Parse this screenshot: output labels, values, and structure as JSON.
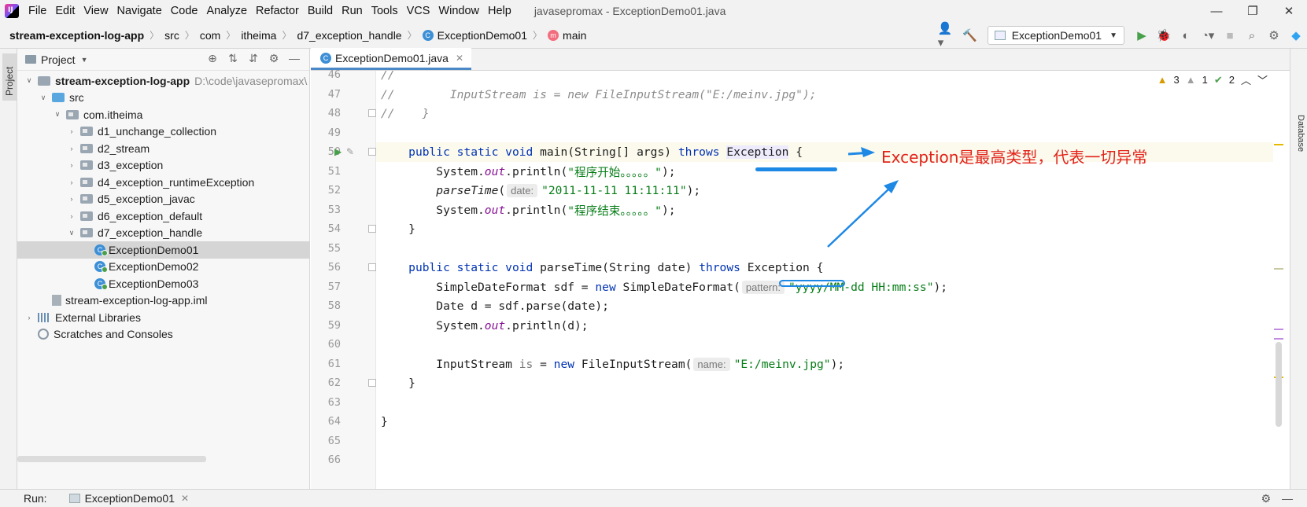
{
  "window": {
    "title": "javasepromax - ExceptionDemo01.java",
    "controls": [
      "—",
      "❐",
      "✕"
    ]
  },
  "menu": [
    "File",
    "Edit",
    "View",
    "Navigate",
    "Code",
    "Analyze",
    "Refactor",
    "Build",
    "Run",
    "Tools",
    "VCS",
    "Window",
    "Help"
  ],
  "breadcrumb": [
    "stream-exception-log-app",
    "src",
    "com",
    "itheima",
    "d7_exception_handle",
    "ExceptionDemo01",
    "main"
  ],
  "toolbar": {
    "run_config": "ExceptionDemo01"
  },
  "project_panel": {
    "title": "Project",
    "stripe_label": "Project",
    "tree": [
      {
        "label": "stream-exception-log-app",
        "note": "D:\\code\\javasepromax\\",
        "depth": 0,
        "icon": "folder",
        "expanded": true,
        "bold": true
      },
      {
        "label": "src",
        "depth": 1,
        "icon": "source-folder",
        "expanded": true
      },
      {
        "label": "com.itheima",
        "depth": 2,
        "icon": "package",
        "expanded": true
      },
      {
        "label": "d1_unchange_collection",
        "depth": 3,
        "icon": "package",
        "expanded": false
      },
      {
        "label": "d2_stream",
        "depth": 3,
        "icon": "package",
        "expanded": false
      },
      {
        "label": "d3_exception",
        "depth": 3,
        "icon": "package",
        "expanded": false
      },
      {
        "label": "d4_exception_runtimeException",
        "depth": 3,
        "icon": "package",
        "expanded": false
      },
      {
        "label": "d5_exception_javac",
        "depth": 3,
        "icon": "package",
        "expanded": false
      },
      {
        "label": "d6_exception_default",
        "depth": 3,
        "icon": "package",
        "expanded": false
      },
      {
        "label": "d7_exception_handle",
        "depth": 3,
        "icon": "package",
        "expanded": true
      },
      {
        "label": "ExceptionDemo01",
        "depth": 4,
        "icon": "class",
        "selected": true
      },
      {
        "label": "ExceptionDemo02",
        "depth": 4,
        "icon": "class"
      },
      {
        "label": "ExceptionDemo03",
        "depth": 4,
        "icon": "class"
      },
      {
        "label": "stream-exception-log-app.iml",
        "depth": 1,
        "icon": "iml"
      },
      {
        "label": "External Libraries",
        "depth": 0,
        "icon": "library",
        "expanded": false
      },
      {
        "label": "Scratches and Consoles",
        "depth": 0,
        "icon": "scratch"
      }
    ]
  },
  "editor": {
    "tab": "ExceptionDemo01.java",
    "inspections": {
      "warnings": "3",
      "weak_warnings": "1",
      "typos": "2"
    },
    "current_line": "50",
    "lines": [
      {
        "n": "46",
        "tokens": [
          {
            "t": "//",
            "c": "cmt"
          }
        ]
      },
      {
        "n": "47",
        "tokens": [
          {
            "t": "//        InputStream is = new FileInputStream(\"E:/meinv.jpg\");",
            "c": "cmt"
          }
        ]
      },
      {
        "n": "48",
        "tokens": [
          {
            "t": "//    }",
            "c": "cmt"
          }
        ]
      },
      {
        "n": "49",
        "tokens": []
      },
      {
        "n": "50",
        "tokens": [
          {
            "t": "    "
          },
          {
            "t": "public static void ",
            "c": "kw"
          },
          {
            "t": "main(String[] args) "
          },
          {
            "t": "throws ",
            "c": "kw"
          },
          {
            "t": "Exception",
            "c": "cursor-word"
          },
          {
            "t": " {"
          }
        ]
      },
      {
        "n": "51",
        "tokens": [
          {
            "t": "        System."
          },
          {
            "t": "out",
            "c": "fld"
          },
          {
            "t": ".println("
          },
          {
            "t": "\"程序开始。。。。。\"",
            "c": "str"
          },
          {
            "t": ");"
          }
        ]
      },
      {
        "n": "52",
        "tokens": [
          {
            "t": "        "
          },
          {
            "t": "parseTime",
            "c": "static-call"
          },
          {
            "t": "("
          },
          {
            "t": "date:",
            "c": "hint"
          },
          {
            "t": "\"2011-11-11 11:11:11\"",
            "c": "str"
          },
          {
            "t": ");"
          }
        ]
      },
      {
        "n": "53",
        "tokens": [
          {
            "t": "        System."
          },
          {
            "t": "out",
            "c": "fld"
          },
          {
            "t": ".println("
          },
          {
            "t": "\"程序结束。。。。。\"",
            "c": "str"
          },
          {
            "t": ");"
          }
        ]
      },
      {
        "n": "54",
        "tokens": [
          {
            "t": "    }"
          }
        ]
      },
      {
        "n": "55",
        "tokens": []
      },
      {
        "n": "56",
        "tokens": [
          {
            "t": "    "
          },
          {
            "t": "public static void ",
            "c": "kw"
          },
          {
            "t": "parseTime(String date) "
          },
          {
            "t": "throws ",
            "c": "kw"
          },
          {
            "t": "Exception {"
          }
        ]
      },
      {
        "n": "57",
        "tokens": [
          {
            "t": "        SimpleDateFormat sdf = "
          },
          {
            "t": "new ",
            "c": "kw"
          },
          {
            "t": "SimpleDateFormat("
          },
          {
            "t": "pattern:",
            "c": "hint"
          },
          {
            "t": "\"yyyy/MM-dd HH:mm:ss\"",
            "c": "str"
          },
          {
            "t": ");"
          }
        ]
      },
      {
        "n": "58",
        "tokens": [
          {
            "t": "        Date d = sdf.parse(date);"
          }
        ]
      },
      {
        "n": "59",
        "tokens": [
          {
            "t": "        System."
          },
          {
            "t": "out",
            "c": "fld"
          },
          {
            "t": ".println(d);"
          }
        ]
      },
      {
        "n": "60",
        "tokens": []
      },
      {
        "n": "61",
        "tokens": [
          {
            "t": "        InputStream "
          },
          {
            "t": "is",
            "c": "weak-var"
          },
          {
            "t": " = "
          },
          {
            "t": "new ",
            "c": "kw"
          },
          {
            "t": "FileInputStream("
          },
          {
            "t": "name:",
            "c": "hint"
          },
          {
            "t": "\"E:/meinv.jpg\"",
            "c": "str"
          },
          {
            "t": ");"
          }
        ]
      },
      {
        "n": "62",
        "tokens": [
          {
            "t": "    }"
          }
        ]
      },
      {
        "n": "63",
        "tokens": []
      },
      {
        "n": "64",
        "tokens": [
          {
            "t": "}"
          }
        ]
      },
      {
        "n": "65",
        "tokens": []
      },
      {
        "n": "66",
        "tokens": []
      }
    ]
  },
  "annotation": {
    "text": "Exception是最高类型，代表一切异常"
  },
  "right_stripe": {
    "label": "Database"
  },
  "run_bar": {
    "label": "Run:",
    "tab": "ExceptionDemo01"
  }
}
